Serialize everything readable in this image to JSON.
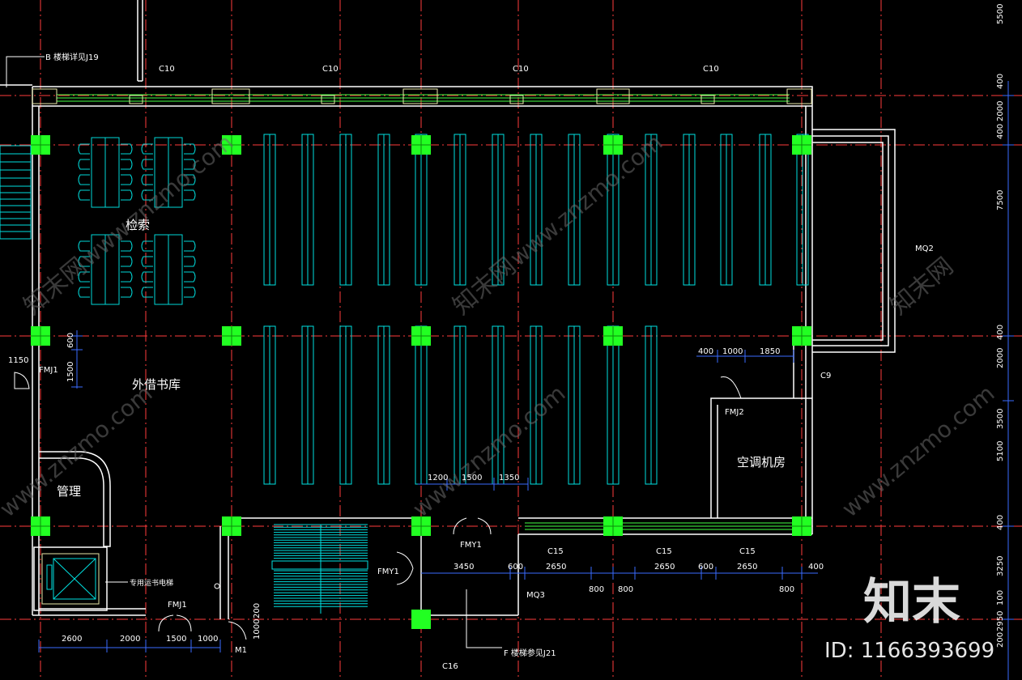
{
  "colors": {
    "background": "#000000",
    "wall": "#ffffff",
    "wall_inner": "#e8e8a8",
    "grid_axis": "#ff3b3b",
    "column": "#22ff22",
    "shelf": "#00e0e0",
    "furniture": "#00d8d8",
    "dimension": "#3a6bff",
    "window": "#44ff44",
    "door": "#ffffff",
    "label": "#ffffff",
    "label_green": "#40ff40"
  },
  "rooms": {
    "index": "检索",
    "lending_stack": "外借书库",
    "management": "管理",
    "ac_room": "空调机房",
    "dedicated_elevator": "专用运书电梯"
  },
  "openings": {
    "window_top": [
      "C10",
      "C10",
      "C10",
      "C10"
    ],
    "window_c15": [
      "C15",
      "C15",
      "C15"
    ],
    "window_c9": "C9",
    "window_c16": "C16",
    "curtain_mq2": "MQ2",
    "curtain_mq3": "MQ3",
    "door_fmj1_left": "FMJ1",
    "door_fmj1_bottom": "FMJ1",
    "door_fmj2": "FMJ2",
    "door_fmy1_a": "FMY1",
    "door_fmy1_b": "FMY1",
    "door_m1": "M1"
  },
  "notes": {
    "stair_b": "B 楼梯详见J19",
    "stair_f": "F 楼梯参见J21"
  },
  "dimensions": {
    "bottom": [
      "2600",
      "2000",
      "1500",
      "1000"
    ],
    "bottom_small": [
      "1000",
      "200"
    ],
    "left": [
      "1150",
      "1500",
      "600"
    ],
    "ac_top": [
      "400",
      "1000",
      "1850"
    ],
    "mid": [
      "1200",
      "1500",
      "1350"
    ],
    "lower_row": [
      "3450",
      "600",
      "2650",
      "2650",
      "600",
      "2650",
      "400"
    ],
    "lower_row2": [
      "800",
      "800",
      "800"
    ],
    "right": [
      "400",
      "2000",
      "400",
      "7500",
      "2000",
      "400",
      "3500",
      "5100",
      "400",
      "3250",
      "100",
      "2950",
      "5500",
      "200"
    ]
  },
  "watermark": {
    "brand_cn": "知末",
    "site": "www.znzmo.com",
    "site_cn": "知末网",
    "id_label": "ID: 1166393699"
  }
}
